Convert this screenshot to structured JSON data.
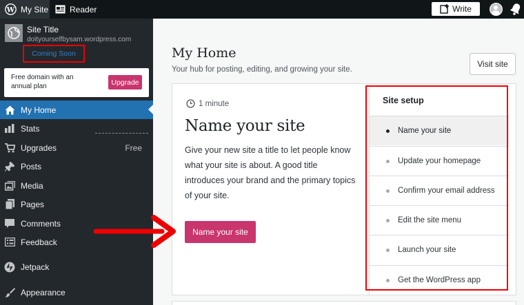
{
  "topbar": {
    "my_site": "My Site",
    "reader": "Reader",
    "write": "Write"
  },
  "sidebar": {
    "site_title": "Site Title",
    "site_url": "doityourselfbysam.wordpress.com",
    "coming_soon": "Coming Soon",
    "domain_text": "Free domain with an annual plan",
    "upgrade": "Upgrade",
    "items": [
      {
        "label": "My Home",
        "icon": "home-icon"
      },
      {
        "label": "Stats",
        "icon": "stats-icon"
      },
      {
        "label": "Upgrades",
        "icon": "cart-icon",
        "sub": "Free"
      },
      {
        "label": "Posts",
        "icon": "pin-icon"
      },
      {
        "label": "Media",
        "icon": "media-icon"
      },
      {
        "label": "Pages",
        "icon": "pages-icon"
      },
      {
        "label": "Comments",
        "icon": "comment-icon"
      },
      {
        "label": "Feedback",
        "icon": "feedback-icon"
      },
      {
        "label": "Jetpack",
        "icon": "jetpack-icon"
      },
      {
        "label": "Appearance",
        "icon": "brush-icon"
      }
    ]
  },
  "main": {
    "title": "My Home",
    "subtitle": "Your hub for posting, editing, and growing your site.",
    "visit_site": "Visit site",
    "task": {
      "time": "1 minute",
      "heading": "Name your site",
      "description": "Give your new site a title to let people know what your site is about. A good title introduces your brand and the primary topics of your site.",
      "button": "Name your site"
    },
    "setup": {
      "title": "Site setup",
      "items": [
        "Name your site",
        "Update your homepage",
        "Confirm your email address",
        "Edit the site menu",
        "Launch your site",
        "Get the WordPress app"
      ]
    }
  },
  "colors": {
    "accent": "#c9356e",
    "sidebar_bg": "#23282d",
    "active_item": "#2271b1",
    "annotation_red": "#e00000"
  }
}
